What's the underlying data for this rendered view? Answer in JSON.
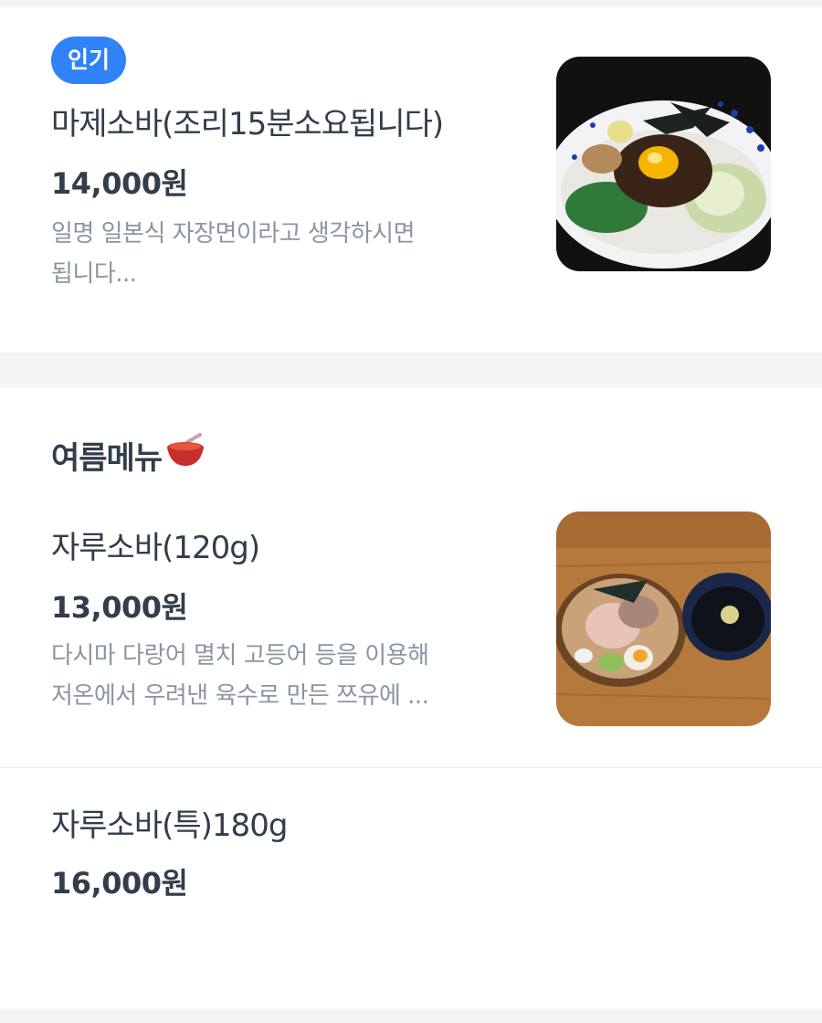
{
  "popular_item": {
    "badge": "인기",
    "name": "마제소바(조리15분소요됩니다)",
    "price": "14,000원",
    "description_line1": "일명 일본식 자장면이라고 생각하시면",
    "description_line2": "됩니다...",
    "image_icon": "mazesoba-bowl-photo"
  },
  "summer_section": {
    "title": "여름메뉴",
    "title_icon": "soup-bowl-icon",
    "items": [
      {
        "name": "자루소바(120g)",
        "price": "13,000원",
        "description_line1": "다시마 다랑어 멸치 고등어 등을 이용해",
        "description_line2": "저온에서 우려낸 육수로 만든 쯔유에 ...",
        "image_icon": "zarusoba-tray-photo"
      },
      {
        "name": "자루소바(특)180g",
        "price": "16,000원"
      }
    ]
  },
  "colors": {
    "accent": "#3182f6",
    "text_primary": "#333d4b",
    "text_secondary": "#8b95a1",
    "background": "#f2f4f6"
  }
}
